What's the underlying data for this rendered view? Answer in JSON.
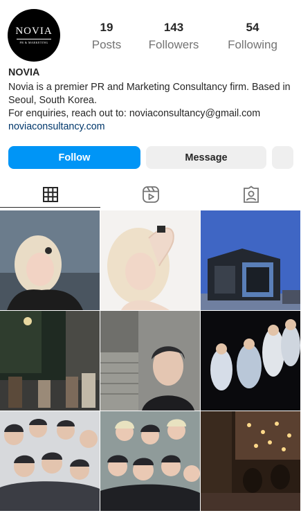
{
  "profile": {
    "avatar_logo_text": "NOVIA",
    "avatar_logo_sub": "PR & MARKETING",
    "username": "NOVIA",
    "bio_lines": [
      "Novia is a premier PR and Marketing Consultancy firm. Based in Seoul, South Korea.",
      "For enquiries, reach out to: noviaconsultancy@gmail.com"
    ],
    "website": "noviaconsultancy.com"
  },
  "stats": {
    "posts": {
      "value": "19",
      "label": "Posts"
    },
    "followers": {
      "value": "143",
      "label": "Followers"
    },
    "following": {
      "value": "54",
      "label": "Following"
    }
  },
  "actions": {
    "follow_label": "Follow",
    "message_label": "Message"
  },
  "tabs": [
    {
      "icon": "grid-icon",
      "active": true
    },
    {
      "icon": "reels-icon",
      "active": false
    },
    {
      "icon": "tagged-icon",
      "active": false
    }
  ],
  "colors": {
    "accent": "#0095f6",
    "link": "#00376b",
    "muted": "#737373",
    "button_secondary": "#efefef"
  },
  "posts": [
    {
      "name": "post-blonde-woman-evening"
    },
    {
      "name": "post-blonde-woman-portrait"
    },
    {
      "name": "post-modern-building"
    },
    {
      "name": "post-night-street"
    },
    {
      "name": "post-man-on-stairs"
    },
    {
      "name": "post-group-night-pose"
    },
    {
      "name": "post-group-photo-boys"
    },
    {
      "name": "post-group-photo-studio"
    },
    {
      "name": "post-cafe-interior"
    }
  ]
}
